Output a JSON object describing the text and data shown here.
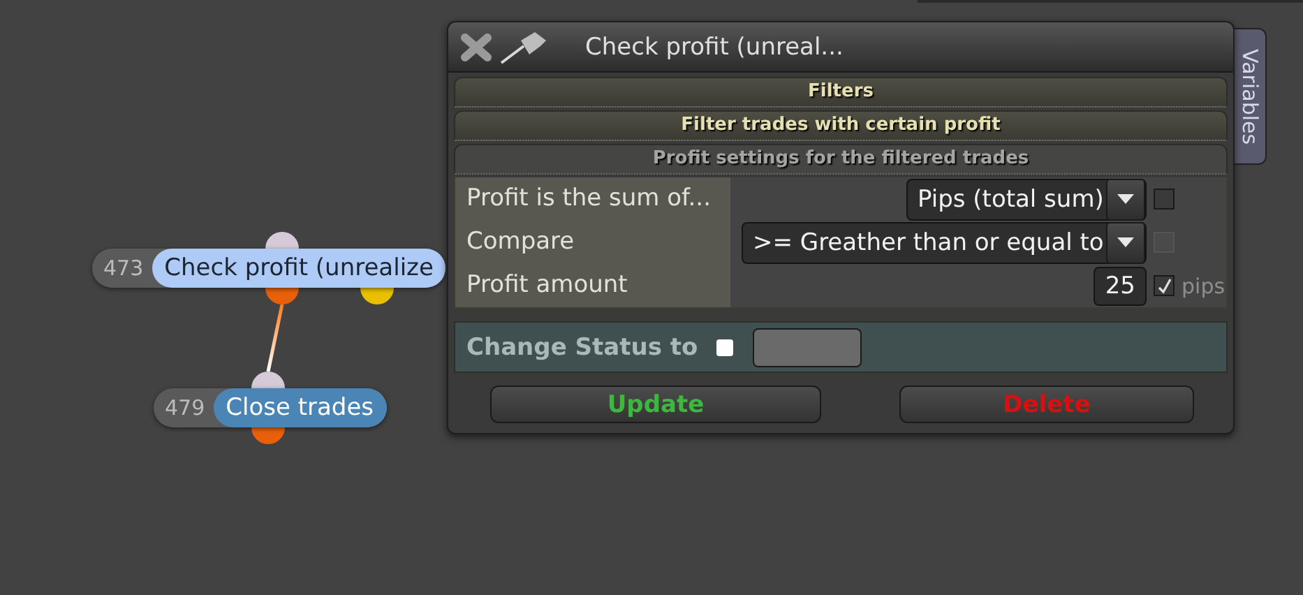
{
  "canvas": {
    "nodes": [
      {
        "number": "473",
        "label": "Check profit (unrealize",
        "kind": "condition",
        "color": "#aecbf7"
      },
      {
        "number": "479",
        "label": "Close trades",
        "kind": "action",
        "color": "#4a85b6"
      }
    ]
  },
  "dialog": {
    "title": "Check profit (unreal...",
    "side_tab": "Variables",
    "sections": [
      {
        "title": "Filters",
        "expanded": false
      },
      {
        "title": "Filter trades with certain profit",
        "expanded": false
      },
      {
        "title": "Profit settings for the filtered trades",
        "expanded": true
      }
    ],
    "rows": [
      {
        "kind": "select",
        "label": "Profit is the sum of...",
        "value": "Pips (total sum)",
        "checked": false,
        "disabled": false
      },
      {
        "kind": "select",
        "label": "Compare",
        "value": ">= Greather than or equal to",
        "checked": false,
        "disabled": true
      },
      {
        "kind": "number",
        "label": "Profit amount",
        "value": "25",
        "checked": true,
        "disabled": false,
        "unit": "pips"
      }
    ],
    "status": {
      "label": "Change Status to",
      "checked": false
    },
    "buttons": [
      {
        "label": "Update",
        "kind": "confirm"
      },
      {
        "label": "Delete",
        "kind": "danger"
      }
    ]
  }
}
